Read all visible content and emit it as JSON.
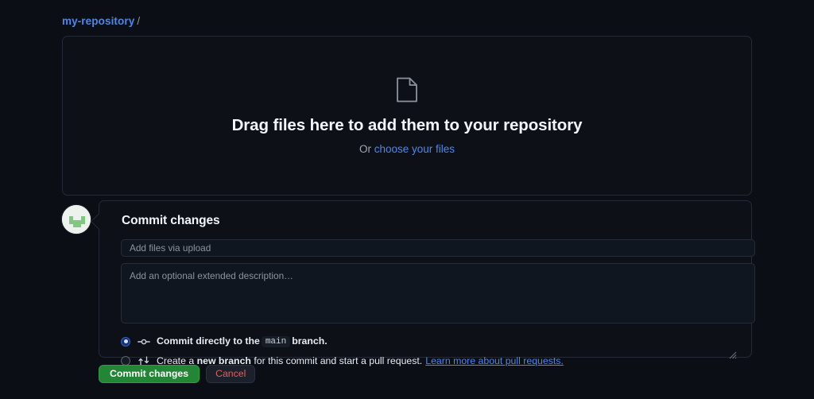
{
  "breadcrumb": {
    "repo_name": "my-repository",
    "separator": "/"
  },
  "dropzone": {
    "icon": "file-icon",
    "title": "Drag files here to add them to your repository",
    "sub_prefix": "Or ",
    "choose_link": "choose your files"
  },
  "commit": {
    "avatar_icon": "user-avatar",
    "panel_title": "Commit changes",
    "summary_value": "Add files via upload",
    "summary_placeholder": "Add files via upload",
    "description_value": "",
    "description_placeholder": "Add an optional extended description…",
    "options": [
      {
        "id": "commit-directly",
        "icon": "git-commit-icon",
        "selected": true,
        "text_before": "Commit directly to the",
        "branch": "main",
        "text_after": "branch.",
        "link": "",
        "bold_word": ""
      },
      {
        "id": "create-branch",
        "icon": "git-pull-request-icon",
        "selected": false,
        "text_before": "Create a",
        "bold_word": "new branch",
        "text_after": "for this commit and start a pull request.",
        "link": "Learn more about pull requests.",
        "branch": ""
      }
    ],
    "submit_label": "Commit changes",
    "cancel_label": "Cancel"
  },
  "colors": {
    "page_background": "#0b0e14",
    "panel_background": "#0d1117",
    "border": "#252b36",
    "link_blue": "#4f86e8",
    "commit_green": "#238636",
    "cancel_red": "#d9625f",
    "text_primary": "#f0f6fc",
    "text_muted": "#8b949e"
  }
}
